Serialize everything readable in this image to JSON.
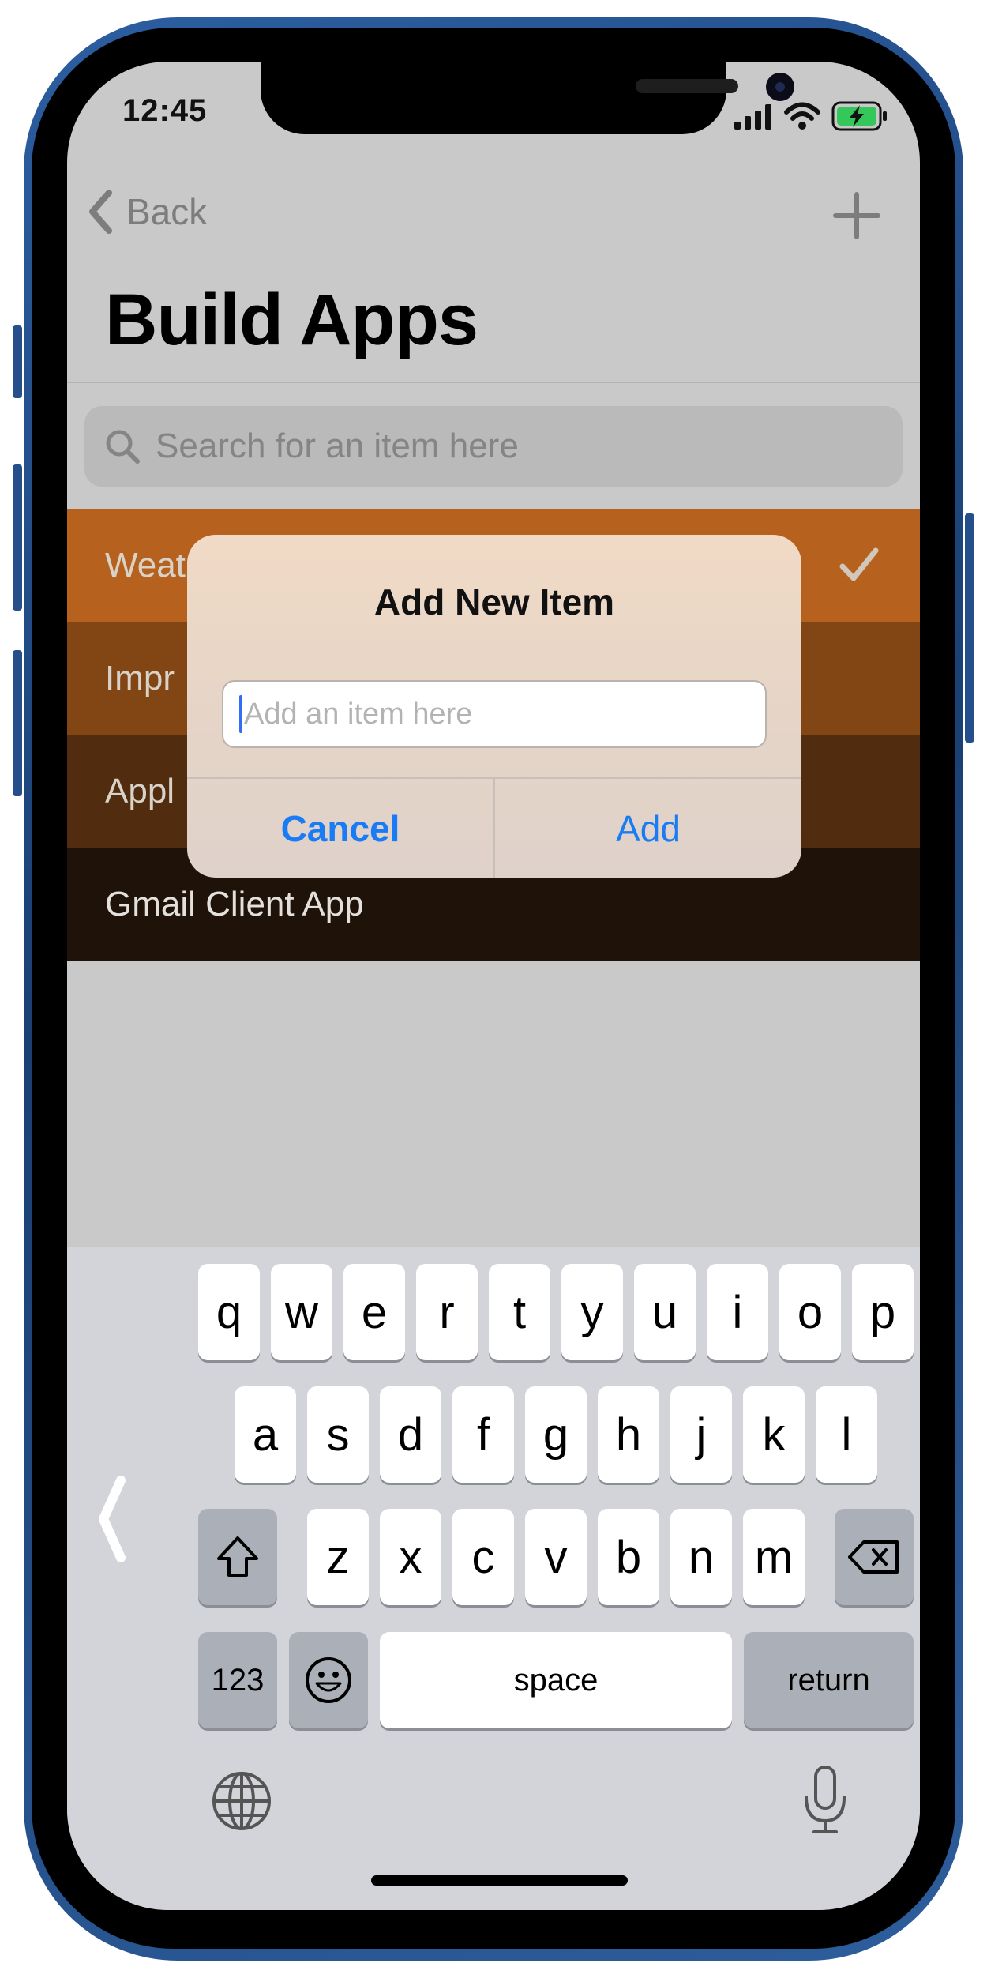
{
  "status_bar": {
    "time": "12:45"
  },
  "nav": {
    "back_label": "Back",
    "title": "Build Apps"
  },
  "search": {
    "placeholder": "Search for an item here"
  },
  "list": {
    "items": [
      {
        "label": "Weat",
        "checked": true,
        "color": "#b6621e"
      },
      {
        "label": "Impr",
        "checked": false,
        "color": "#824615"
      },
      {
        "label": "Appl",
        "checked": false,
        "color": "#512c0e"
      },
      {
        "label": "Gmail Client App",
        "checked": false,
        "color": "#1e1209"
      }
    ]
  },
  "alert": {
    "title": "Add New Item",
    "placeholder": "Add an item here",
    "cancel_label": "Cancel",
    "add_label": "Add"
  },
  "keyboard": {
    "row1": [
      "q",
      "w",
      "e",
      "r",
      "t",
      "y",
      "u",
      "i",
      "o",
      "p"
    ],
    "row2": [
      "a",
      "s",
      "d",
      "f",
      "g",
      "h",
      "j",
      "k",
      "l"
    ],
    "row3": [
      "z",
      "x",
      "c",
      "v",
      "b",
      "n",
      "m"
    ],
    "numbers_label": "123",
    "space_label": "space",
    "return_label": "return"
  },
  "colors": {
    "accent": "#1a7cf5",
    "keyboard_bg": "#d2d4d9"
  }
}
